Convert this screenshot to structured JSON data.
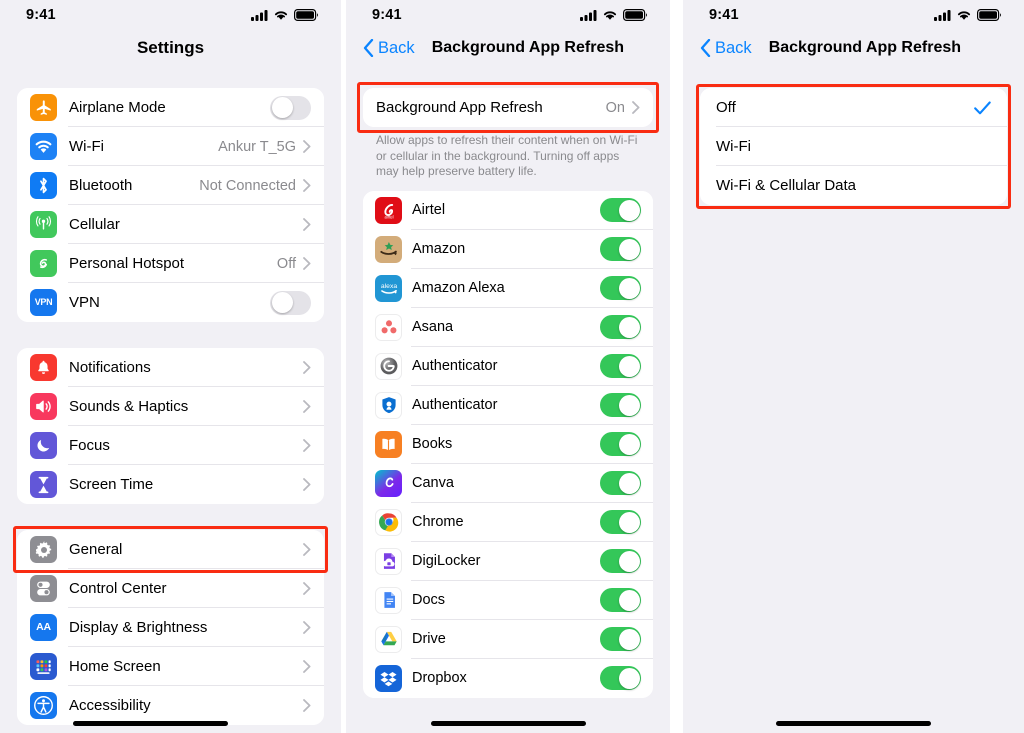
{
  "statusbar": {
    "time": "9:41",
    "icons": [
      "cellular-signal-icon",
      "wifi-icon",
      "battery-icon"
    ]
  },
  "panel1": {
    "nav": {
      "title": "Settings"
    },
    "groups": [
      {
        "rows": [
          {
            "icon": "airplane-icon",
            "label": "Airplane Mode",
            "control": "switch",
            "value": "off"
          },
          {
            "icon": "wifi-icon",
            "label": "Wi-Fi",
            "control": "value-chevron",
            "value": "Ankur T_5G"
          },
          {
            "icon": "bluetooth-icon",
            "label": "Bluetooth",
            "control": "value-chevron",
            "value": "Not Connected"
          },
          {
            "icon": "cellular-icon",
            "label": "Cellular",
            "control": "chevron",
            "value": ""
          },
          {
            "icon": "hotspot-icon",
            "label": "Personal Hotspot",
            "control": "value-chevron",
            "value": "Off"
          },
          {
            "icon": "vpn-icon",
            "label": "VPN",
            "control": "switch",
            "value": "off"
          }
        ]
      },
      {
        "rows": [
          {
            "icon": "notifications-bell-icon",
            "label": "Notifications",
            "control": "chevron",
            "value": ""
          },
          {
            "icon": "sounds-speaker-icon",
            "label": "Sounds & Haptics",
            "control": "chevron",
            "value": ""
          },
          {
            "icon": "focus-moon-icon",
            "label": "Focus",
            "control": "chevron",
            "value": ""
          },
          {
            "icon": "screen-time-hourglass-icon",
            "label": "Screen Time",
            "control": "chevron",
            "value": ""
          }
        ]
      },
      {
        "rows": [
          {
            "icon": "general-gear-icon",
            "label": "General",
            "control": "chevron",
            "value": ""
          },
          {
            "icon": "control-center-icon",
            "label": "Control Center",
            "control": "chevron",
            "value": ""
          },
          {
            "icon": "display-brightness-icon",
            "label": "Display & Brightness",
            "control": "chevron",
            "value": ""
          },
          {
            "icon": "home-screen-icon",
            "label": "Home Screen",
            "control": "chevron",
            "value": ""
          },
          {
            "icon": "accessibility-icon",
            "label": "Accessibility",
            "control": "chevron",
            "value": ""
          }
        ]
      }
    ],
    "highlight": {
      "target": "General"
    }
  },
  "panel2": {
    "nav": {
      "back_label": "Back",
      "title": "Background App Refresh"
    },
    "toggle_row": {
      "label": "Background App Refresh",
      "value": "On"
    },
    "footnote": "Allow apps to refresh their content when on Wi-Fi or cellular in the background. Turning off apps may help preserve battery life.",
    "apps": [
      {
        "icon": "airtel-app-icon",
        "label": "Airtel",
        "state": "on"
      },
      {
        "icon": "amazon-app-icon",
        "label": "Amazon",
        "state": "on"
      },
      {
        "icon": "amazon-alexa-app-icon",
        "label": "Amazon Alexa",
        "state": "on"
      },
      {
        "icon": "asana-app-icon",
        "label": "Asana",
        "state": "on"
      },
      {
        "icon": "authenticator-gray-app-icon",
        "label": "Authenticator",
        "state": "on"
      },
      {
        "icon": "authenticator-blue-app-icon",
        "label": "Authenticator",
        "state": "on"
      },
      {
        "icon": "books-app-icon",
        "label": "Books",
        "state": "on"
      },
      {
        "icon": "canva-app-icon",
        "label": "Canva",
        "state": "on"
      },
      {
        "icon": "chrome-app-icon",
        "label": "Chrome",
        "state": "on"
      },
      {
        "icon": "digilocker-app-icon",
        "label": "DigiLocker",
        "state": "on"
      },
      {
        "icon": "docs-app-icon",
        "label": "Docs",
        "state": "on"
      },
      {
        "icon": "drive-app-icon",
        "label": "Drive",
        "state": "on"
      },
      {
        "icon": "dropbox-app-icon",
        "label": "Dropbox",
        "state": "on"
      }
    ]
  },
  "panel3": {
    "nav": {
      "back_label": "Back",
      "title": "Background App Refresh"
    },
    "options": [
      {
        "label": "Off",
        "selected": true
      },
      {
        "label": "Wi-Fi",
        "selected": false
      },
      {
        "label": "Wi-Fi & Cellular Data",
        "selected": false
      }
    ]
  },
  "colors": {
    "accent_blue": "#0a84ff",
    "switch_on_green": "#34c759",
    "highlight_red": "#f92c12",
    "page_bg": "#f1f0f5"
  }
}
